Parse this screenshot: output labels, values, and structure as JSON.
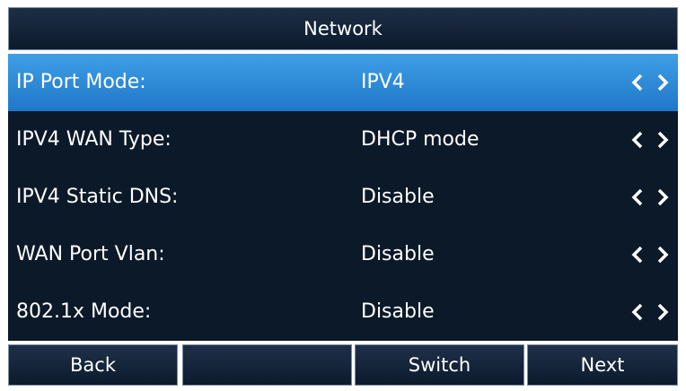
{
  "header": {
    "title": "Network"
  },
  "rows": [
    {
      "label": "IP Port Mode:",
      "value": "IPV4"
    },
    {
      "label": "IPV4 WAN Type:",
      "value": "DHCP mode"
    },
    {
      "label": "IPV4 Static DNS:",
      "value": "Disable"
    },
    {
      "label": "WAN Port Vlan:",
      "value": "Disable"
    },
    {
      "label": "802.1x Mode:",
      "value": "Disable"
    }
  ],
  "selected_row": 0,
  "softkeys": [
    "Back",
    "",
    "Switch",
    "Next"
  ],
  "icons": {
    "left": "chevron-left-icon",
    "right": "chevron-right-icon"
  },
  "colors": {
    "background": "#0b1929",
    "selection": "#2f8ad9",
    "text": "#ffffff",
    "border": "#7c8da2"
  }
}
